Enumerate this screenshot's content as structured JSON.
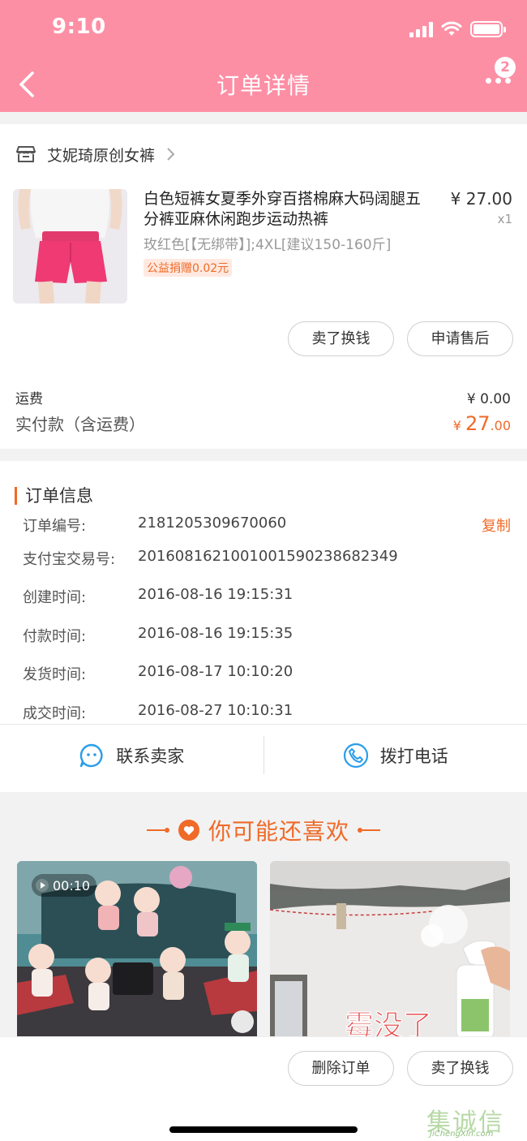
{
  "status_bar": {
    "time": "9:10"
  },
  "nav": {
    "title": "订单详情",
    "badge": "2"
  },
  "order": {
    "shop_name": "艾妮琦原创女裤",
    "product_title": "白色短裤女夏季外穿百搭棉麻大码阔腿五分裤亚麻休闲跑步运动热裤",
    "sku": "玫红色[【无绑带】];4XL[建议150-160斤]",
    "charity": "公益捐赠0.02元",
    "price": "¥ 27.00",
    "qty": "x1",
    "btn_sell": "卖了换钱",
    "btn_aftersale": "申请售后",
    "freight_label": "运费",
    "freight_value": "¥ 0.00",
    "paid_label": "实付款（含运费）",
    "paid_currency": "¥ ",
    "paid_int": "27",
    "paid_dec": ".00"
  },
  "order_info": {
    "title": "订单信息",
    "copy": "复制",
    "rows": [
      {
        "label": "订单编号:",
        "value": "2181205309670060"
      },
      {
        "label": "支付宝交易号:",
        "value": "2016081621001001590238682349"
      },
      {
        "label": "创建时间:",
        "value": "2016-08-16 19:15:31"
      },
      {
        "label": "付款时间:",
        "value": "2016-08-16 19:15:35"
      },
      {
        "label": "发货时间:",
        "value": "2016-08-17 10:10:20"
      },
      {
        "label": "成交时间:",
        "value": "2016-08-27 10:10:31"
      }
    ],
    "contact_seller": "联系卖家",
    "call_phone": "拨打电话"
  },
  "recommend": {
    "title": "你可能还喜欢",
    "video_time": "00:10",
    "item2_caption": "霉没了"
  },
  "bottom": {
    "btn_delete": "删除订单",
    "btn_sell": "卖了换钱"
  },
  "watermark": {
    "main": "集诚信",
    "sub": "JiChengXin.com"
  },
  "colors": {
    "header": "#fd8fa5",
    "accent": "#f06a28",
    "icon_blue": "#2a9ee8"
  }
}
